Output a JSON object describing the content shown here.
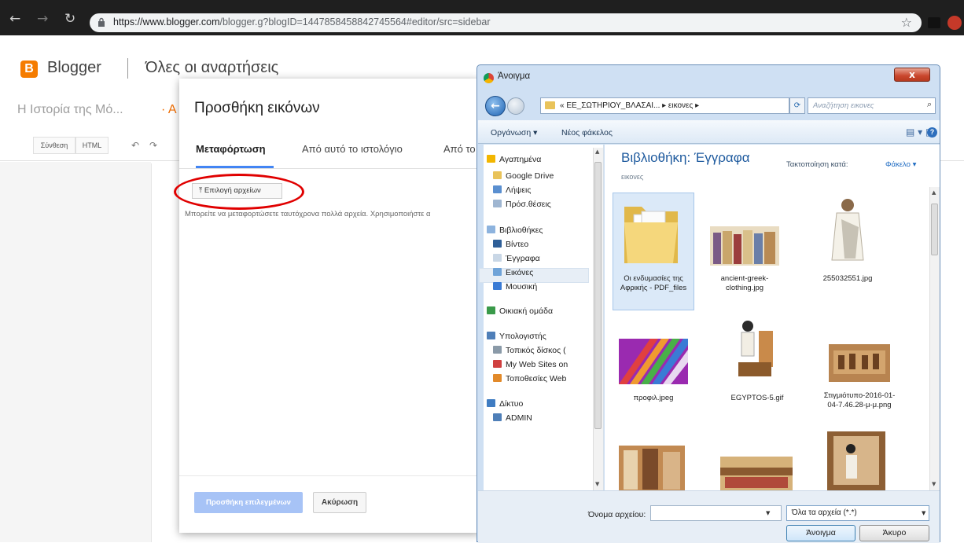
{
  "browser": {
    "url_host": "https://www.blogger.com",
    "url_path": "/blogger.g?blogID=1447858458842745564#editor/src=sidebar",
    "icons": [
      "back-icon",
      "forward-icon",
      "reload-icon",
      "lock-icon",
      "star-icon"
    ]
  },
  "blogger": {
    "brand": "Blogger",
    "logo_letter": "B",
    "posts_heading": "Όλες οι αναρτήσεις",
    "blog_title": "Η Ιστορία της Μό...",
    "blog_title_accent": "· Α",
    "toolbar": {
      "compose": "Σύνθεση",
      "html": "HTML",
      "undo": "↶",
      "redo": "↷"
    },
    "colors": {
      "accent": "#f57c00",
      "link": "#4285f4"
    }
  },
  "add_images_dialog": {
    "title": "Προσθήκη εικόνων",
    "tabs": [
      {
        "label": "Μεταφόρτωση",
        "active": true
      },
      {
        "label": "Από αυτό το ιστολόγιο",
        "active": false
      },
      {
        "label": "Από το",
        "active": false
      }
    ],
    "choose_files": "⤒ Επιλογή αρχείων",
    "hint": "Μπορείτε να μεταφορτώσετε ταυτόχρονα πολλά αρχεία. Χρησιμοποιήστε α",
    "add_selected": "Προσθήκη επιλεγμένων",
    "cancel": "Ακύρωση"
  },
  "open_dialog": {
    "title": "Άνοιγμα",
    "close": "x",
    "address": "« ΕΕ_ΣΩΤΗΡΙΟΥ_ΒΛΑΣΑΙ... ▸ εικονες ▸",
    "search_placeholder": "Αναζήτηση εικονες",
    "toolbar": {
      "organize": "Οργάνωση ▾",
      "new_folder": "Νέος φάκελος"
    },
    "nav": [
      {
        "label": "Αγαπημένα",
        "icon": "star-icon",
        "color": "#f2b600"
      },
      {
        "label": "Google Drive",
        "icon": "drive-folder-icon",
        "color": "#e9c35a"
      },
      {
        "label": "Λήψεις",
        "icon": "downloads-folder-icon",
        "color": "#5a8fd0"
      },
      {
        "label": "Πρόσ.θέσεις",
        "icon": "recent-places-icon",
        "color": "#9fb6d1"
      },
      {
        "label": "Βιβλιοθήκες",
        "icon": "libraries-icon",
        "color": "#8db3de"
      },
      {
        "label": "Βίντεο",
        "icon": "video-icon",
        "color": "#2f5f98"
      },
      {
        "label": "Έγγραφα",
        "icon": "documents-icon",
        "color": "#c9d7e6"
      },
      {
        "label": "Εικόνες",
        "icon": "pictures-icon",
        "color": "#6fa3d8"
      },
      {
        "label": "Μουσική",
        "icon": "music-icon",
        "color": "#3a7bd5"
      },
      {
        "label": "Οικιακή ομάδα",
        "icon": "homegroup-icon",
        "color": "#3a9a4a"
      },
      {
        "label": "Υπολογιστής",
        "icon": "computer-icon",
        "color": "#4f7fb8"
      },
      {
        "label": "Τοπικός δίσκος (",
        "icon": "local-disk-icon",
        "color": "#8a9aa8"
      },
      {
        "label": "My Web Sites on",
        "icon": "web-sites-icon",
        "color": "#d04040"
      },
      {
        "label": "Τοποθεσίες Web",
        "icon": "web-locations-icon",
        "color": "#e28a2a"
      },
      {
        "label": "Δίκτυο",
        "icon": "network-icon",
        "color": "#3f7cc2"
      },
      {
        "label": "ADMIN",
        "icon": "computer-icon",
        "color": "#4f7fb8"
      }
    ],
    "library_title": "Βιβλιοθήκη: Έγγραφα",
    "library_sub": "εικονες",
    "sort_label": "Τακτοποίηση κατά:",
    "sort_value": "Φάκελο ▾",
    "files": [
      {
        "label": "Οι ενδυμασίες της Αφρικής - PDF_files",
        "kind": "folder"
      },
      {
        "label": "ancient-greek-clothing.jpg",
        "kind": "image"
      },
      {
        "label": "255032551.jpg",
        "kind": "image"
      },
      {
        "label": "προφιλ.jpeg",
        "kind": "image"
      },
      {
        "label": "EGYPTOS-5.gif",
        "kind": "image"
      },
      {
        "label": "Στιγμιότυπο-2016-01-04-7.46.28-μ-μ.png",
        "kind": "image"
      }
    ],
    "filename_label": "Όνομα αρχείου:",
    "filename_value": "",
    "filetype": "Όλα τα αρχεία (*.*)",
    "open_button": "Άνοιγμα",
    "cancel_button": "Άκυρο"
  }
}
